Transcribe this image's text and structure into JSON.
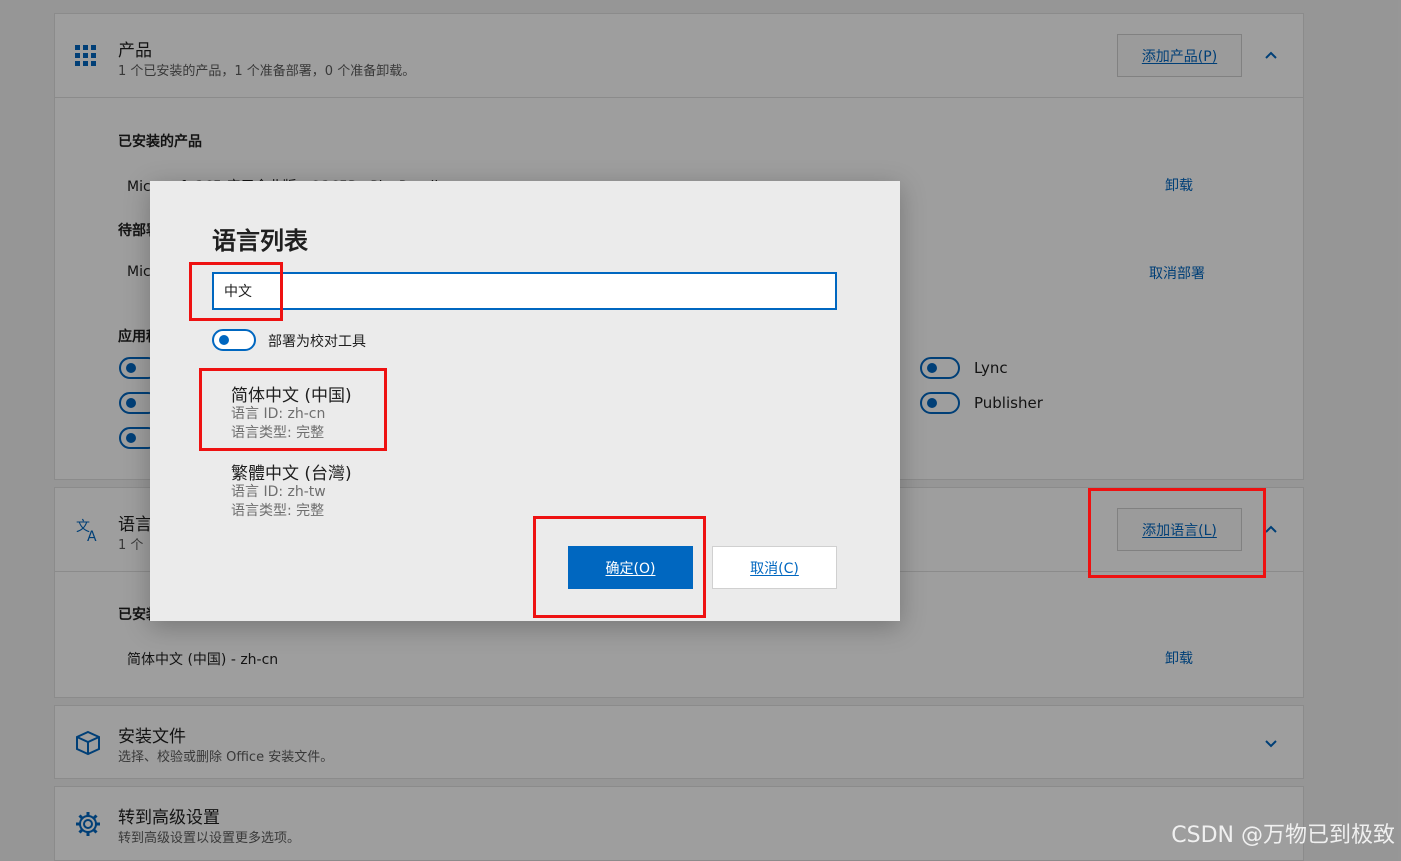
{
  "products": {
    "title": "产品",
    "subtitle": "1 个已安装的产品，1 个准备部署，0 个准备卸载。",
    "add_button": "添加产品(P)",
    "installed_label": "已安装的产品",
    "installed_item": "Microsoft 365 应用企业版 - O365ProPlusRetail",
    "uninstall_link": "卸载",
    "pending_label": "待部署",
    "pending_item": "Mic",
    "cancel_deploy_link": "取消部署",
    "apps_label": "应用程序",
    "app_toggles": [
      "Lync",
      "Publisher"
    ]
  },
  "languages": {
    "title": "语言",
    "subtitle": "1 个",
    "add_button": "添加语言(L)",
    "installed_label": "已安装",
    "installed_item": "简体中文 (中国)  -  zh-cn",
    "uninstall_link": "卸载"
  },
  "install_files": {
    "title": "安装文件",
    "subtitle": "选择、校验或删除 Office 安装文件。"
  },
  "advanced": {
    "title": "转到高级设置",
    "subtitle": "转到高级设置以设置更多选项。"
  },
  "dialog": {
    "title": "语言列表",
    "search_value": "中文",
    "proofing_toggle_label": "部署为校对工具",
    "languages": [
      {
        "name": "简体中文 (中国)",
        "id": "语言 ID: zh-cn",
        "type": "语言类型: 完整"
      },
      {
        "name": "繁體中文 (台灣)",
        "id": "语言 ID: zh-tw",
        "type": "语言类型: 完整"
      }
    ],
    "ok_button": "确定(O)",
    "cancel_button": "取消(C)"
  },
  "watermark": "CSDN @万物已到极致",
  "colors": {
    "accent": "#0067c0",
    "highlight": "#ee1111"
  }
}
